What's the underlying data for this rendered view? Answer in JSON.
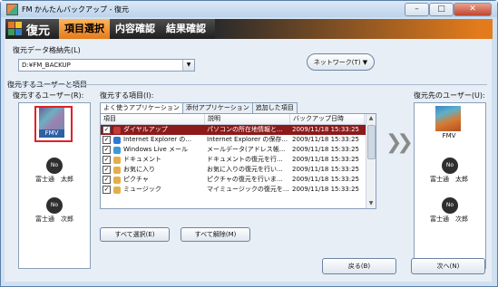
{
  "window": {
    "title": "FM かんたんバックアップ - 復元",
    "minimize": "–",
    "maximize": "□",
    "close": "✕"
  },
  "header": {
    "title": "復元",
    "steps": [
      "項目選択",
      "内容確認",
      "結果確認"
    ]
  },
  "destination": {
    "label": "復元データ格納先(L)",
    "value": "D:¥FM_BACKUP",
    "network_button": "ネットワーク(T) ▼"
  },
  "section_label": "復元するユーザーと項目",
  "source_users": {
    "label": "復元するユーザー(R):",
    "users": [
      {
        "name": "FMV",
        "selected": true
      },
      {
        "name": "富士通　太郎",
        "avatar_text": "No"
      },
      {
        "name": "富士通　次郎",
        "avatar_text": "No"
      }
    ]
  },
  "items": {
    "label": "復元する項目(I):",
    "tabs": [
      "よく使うアプリケーション",
      "添付アプリケーション",
      "追加した項目"
    ],
    "columns": [
      "項目",
      "説明",
      "バックアップ日時"
    ],
    "rows": [
      {
        "name": "ダイヤルアップ",
        "desc": "パソコンの所在地情報と...",
        "date": "2009/11/18 15:33:25",
        "selected": true,
        "icon_color": "#c23b3b"
      },
      {
        "name": "Internet Explorer の...",
        "desc": "Internet Explorer の保存...",
        "date": "2009/11/18 15:33:25",
        "icon_color": "#2d7ad6"
      },
      {
        "name": "Windows Live メール",
        "desc": "メールデータ(アドレス帳...",
        "date": "2009/11/18 15:33:25",
        "icon_color": "#3a9ad9"
      },
      {
        "name": "ドキュメント",
        "desc": "ドキュメントの復元を行...",
        "date": "2009/11/18 15:33:25",
        "icon_color": "#e1b04a"
      },
      {
        "name": "お気に入り",
        "desc": "お気に入りの復元を行い...",
        "date": "2009/11/18 15:33:25",
        "icon_color": "#e1b04a"
      },
      {
        "name": "ピクチャ",
        "desc": "ピクチャの復元を行いま...",
        "date": "2009/11/18 15:33:25",
        "icon_color": "#e1b04a"
      },
      {
        "name": "ミュージック",
        "desc": "マイミュージックの復元を...",
        "date": "2009/11/18 15:33:25",
        "icon_color": "#e1b04a"
      }
    ],
    "select_all": "すべて選択(E)",
    "deselect_all": "すべて解除(M)"
  },
  "target_users": {
    "label": "復元先のユーザー(U):",
    "users": [
      {
        "name": "FMV"
      },
      {
        "name": "富士通　太郎",
        "avatar_text": "No"
      },
      {
        "name": "富士通　次郎",
        "avatar_text": "No"
      }
    ]
  },
  "footer": {
    "back": "戻る(B)",
    "next": "次へ(N)"
  },
  "colors": {
    "accent_orange": "#e37b1c",
    "selected_row": "#8c1a1a",
    "selection_frame": "#e0202a"
  }
}
